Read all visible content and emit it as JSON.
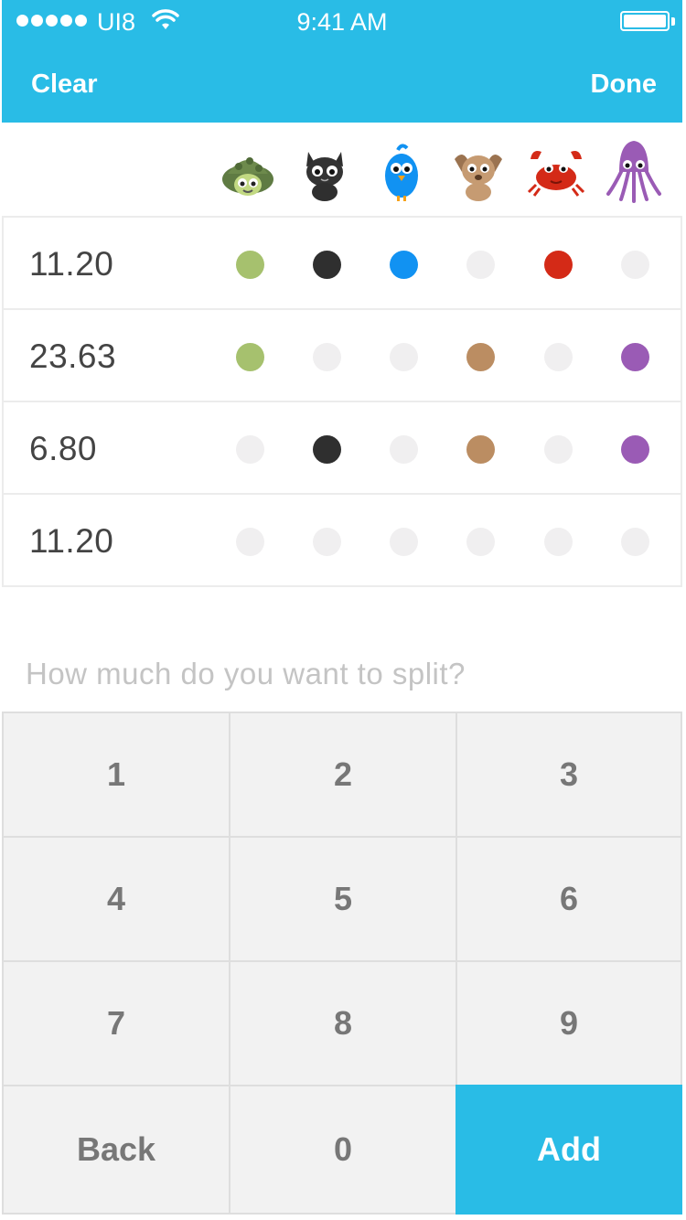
{
  "status_bar": {
    "carrier": "UI8",
    "time": "9:41 AM",
    "signal_icon": "signal-dots-icon",
    "wifi_icon": "wifi-icon",
    "battery_icon": "battery-icon"
  },
  "nav": {
    "clear_label": "Clear",
    "done_label": "Done",
    "background": "#29bce6"
  },
  "people": [
    {
      "name": "turtle",
      "color": "#a6c16e"
    },
    {
      "name": "cat",
      "color": "#2f2f2f"
    },
    {
      "name": "bird",
      "color": "#1192f2"
    },
    {
      "name": "dog",
      "color": "#bb8d62"
    },
    {
      "name": "crab",
      "color": "#d42a17"
    },
    {
      "name": "squid",
      "color": "#9a5bb5"
    }
  ],
  "rows": [
    {
      "amount": "11.20",
      "selected": [
        true,
        true,
        true,
        false,
        true,
        false
      ]
    },
    {
      "amount": "23.63",
      "selected": [
        true,
        false,
        false,
        true,
        false,
        true
      ]
    },
    {
      "amount": "6.80",
      "selected": [
        false,
        true,
        false,
        true,
        false,
        true
      ]
    },
    {
      "amount": "11.20",
      "selected": [
        false,
        false,
        false,
        false,
        false,
        false
      ]
    }
  ],
  "prompt": "How much do you want to split?",
  "keypad": {
    "keys": [
      [
        "1",
        "2",
        "3"
      ],
      [
        "4",
        "5",
        "6"
      ],
      [
        "7",
        "8",
        "9"
      ],
      [
        "Back",
        "0",
        "Add"
      ]
    ],
    "inactive_dot_color": "#f0eff0",
    "accent": "#29bce6"
  }
}
